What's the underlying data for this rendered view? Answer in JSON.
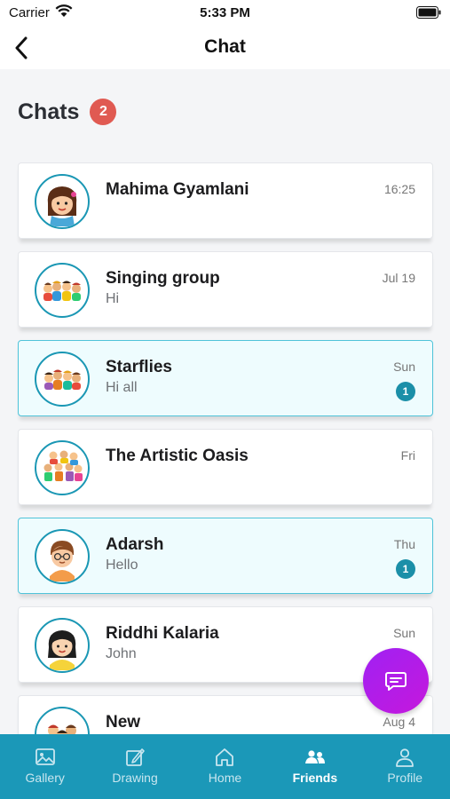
{
  "status_bar": {
    "carrier": "Carrier",
    "time": "5:33 PM"
  },
  "nav": {
    "title": "Chat"
  },
  "section": {
    "title": "Chats",
    "count": "2"
  },
  "chats": [
    {
      "name": "Mahima Gyamlani",
      "preview": "",
      "time": "16:25",
      "unread": ""
    },
    {
      "name": "Singing group",
      "preview": "Hi",
      "time": "Jul 19",
      "unread": ""
    },
    {
      "name": "Starflies",
      "preview": "Hi all",
      "time": "Sun",
      "unread": "1"
    },
    {
      "name": "The Artistic Oasis",
      "preview": "",
      "time": "Fri",
      "unread": ""
    },
    {
      "name": "Adarsh",
      "preview": "Hello",
      "time": "Thu",
      "unread": "1"
    },
    {
      "name": "Riddhi Kalaria",
      "preview": "John",
      "time": "Sun",
      "unread": ""
    },
    {
      "name": "New",
      "preview": "",
      "time": "Aug 4",
      "unread": ""
    }
  ],
  "tabs": [
    {
      "label": "Gallery",
      "icon": "gallery-icon"
    },
    {
      "label": "Drawing",
      "icon": "drawing-icon"
    },
    {
      "label": "Home",
      "icon": "home-icon"
    },
    {
      "label": "Friends",
      "icon": "friends-icon"
    },
    {
      "label": "Profile",
      "icon": "profile-icon"
    }
  ],
  "active_tab": "Friends",
  "colors": {
    "accent": "#1b98b8",
    "badge": "#e05a52",
    "fab": "#b21de8",
    "unread_bg": "#eefcfe"
  }
}
